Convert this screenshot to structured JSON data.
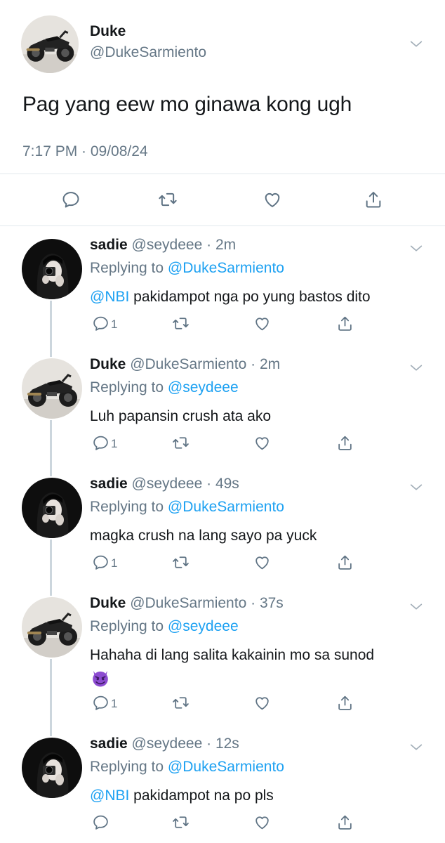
{
  "main_tweet": {
    "name": "Duke",
    "handle": "@DukeSarmiento",
    "text": "Pag yang eew mo ginawa kong ugh",
    "timestamp": "7:17 PM · 09/08/24",
    "icons": [
      "reply-icon",
      "retweet-icon",
      "like-icon",
      "share-icon"
    ]
  },
  "replies": [
    {
      "name": "sadie",
      "handle": "@seydeee",
      "time": "2m",
      "replying_label": "Replying to",
      "replying_to": "@DukeSarmiento",
      "mention": "@NBI",
      "text": " pakidampot nga po yung bastos dito",
      "reply_count": "1"
    },
    {
      "name": "Duke",
      "handle": "@DukeSarmiento",
      "time": "2m",
      "replying_label": "Replying to",
      "replying_to": "@seydeee",
      "mention": "",
      "text": "Luh papansin crush ata ako",
      "reply_count": "1"
    },
    {
      "name": "sadie",
      "handle": "@seydeee",
      "time": "49s",
      "replying_label": "Replying to",
      "replying_to": "@DukeSarmiento",
      "mention": "",
      "text": "magka crush na lang sayo pa yuck",
      "reply_count": "1"
    },
    {
      "name": "Duke",
      "handle": "@DukeSarmiento",
      "time": "37s",
      "replying_label": "Replying to",
      "replying_to": "@seydeee",
      "mention": "",
      "text": "Hahaha di lang salita kakainin mo sa sunod",
      "emoji": "smiling-devil-emoji",
      "reply_count": "1"
    },
    {
      "name": "sadie",
      "handle": "@seydeee",
      "time": "12s",
      "replying_label": "Replying to",
      "replying_to": "@DukeSarmiento",
      "mention": "@NBI",
      "text": " pakidampot na po pls",
      "reply_count": ""
    }
  ],
  "colors": {
    "link": "#1da1f2",
    "secondary_text": "#657786",
    "icon": "#5f7384",
    "separator": "#e1e8ed",
    "thread_line": "#ccd6dd",
    "emoji": "#8c4bd1"
  }
}
